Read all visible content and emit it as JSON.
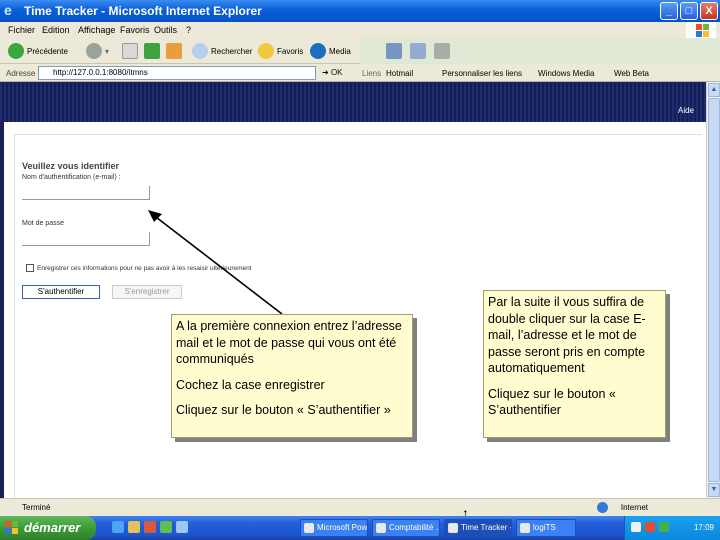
{
  "window": {
    "title": "Time Tracker - Microsoft Internet Explorer",
    "minimize": "_",
    "maximize": "□",
    "close": "X"
  },
  "menu": {
    "items": [
      "Fichier",
      "Edition",
      "Affichage",
      "Favoris",
      "Outils",
      "?"
    ]
  },
  "toolbar": {
    "back_label": "Précédente",
    "search_label": "Rechercher",
    "favorites_label": "Favoris",
    "media_label": "Media"
  },
  "address": {
    "label": "Adresse",
    "value": "http://127.0.0.1:8080/itmns",
    "go_label": "OK",
    "links_label": "Liens",
    "links": [
      "Hotmail",
      "Personnaliser les liens",
      "Windows Media",
      "Web Beta"
    ]
  },
  "page": {
    "help_label": "Aide",
    "heading": "Veuillez vous identifier",
    "login_label": "Nom d'authentification (e-mail) :",
    "password_label": "Mot de passe",
    "remember_label": "Enregistrer ces informations pour ne pas avoir à les resaisir ultérieurement",
    "remember_checked": false,
    "auth_button": "S'authentifier",
    "register_button": "S'enregistrer"
  },
  "callouts": {
    "left": {
      "para1": "A la première connexion entrez l’adresse mail et le mot de passe qui vous ont été communiqués",
      "para2": "Cochez la case enregistrer",
      "para3": "Cliquez sur le bouton « S’authentifier »"
    },
    "right": {
      "para1": "Par la suite il vous suffira de double cliquer sur la case E-mail, l’adresse et le mot de passe seront pris en compte automatiquement",
      "para2": "Cliquez sur le bouton « S’authentifier"
    }
  },
  "status": {
    "text": "Terminé",
    "zone": "Internet"
  },
  "taskbar": {
    "start_label": "démarrer",
    "tasks": [
      "Microsoft Pow...",
      "Comptabilité ...",
      "Time Tracker - ...",
      "logiTS"
    ],
    "clock": "17:09"
  },
  "colors": {
    "callout_bg": "#fffdd0",
    "banner": "#1a245f",
    "titlebar": "#0a5fd8"
  }
}
